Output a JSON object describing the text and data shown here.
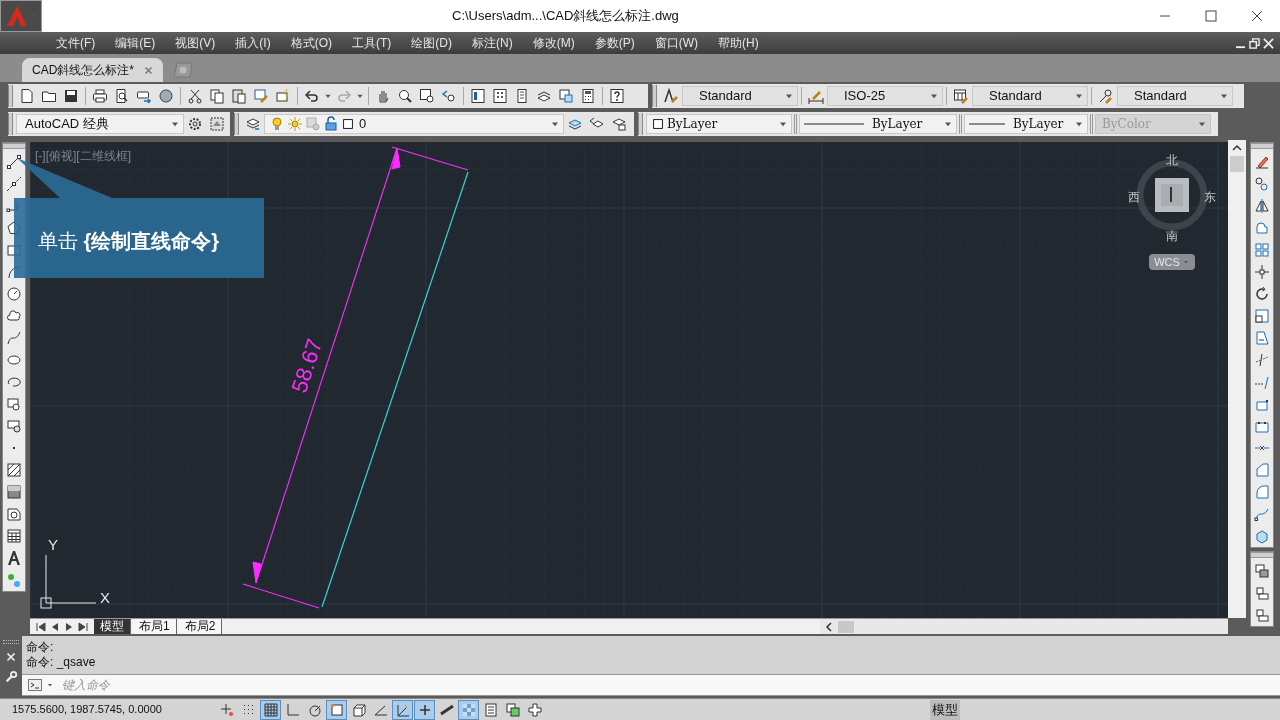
{
  "window": {
    "title": "C:\\Users\\adm...\\CAD斜线怎么标注.dwg"
  },
  "menu": [
    {
      "label": "文件(F)"
    },
    {
      "label": "编辑(E)"
    },
    {
      "label": "视图(V)"
    },
    {
      "label": "插入(I)"
    },
    {
      "label": "格式(O)"
    },
    {
      "label": "工具(T)"
    },
    {
      "label": "绘图(D)"
    },
    {
      "label": "标注(N)"
    },
    {
      "label": "修改(M)"
    },
    {
      "label": "参数(P)"
    },
    {
      "label": "窗口(W)"
    },
    {
      "label": "帮助(H)"
    }
  ],
  "document_tabs": [
    {
      "label": "CAD斜线怎么标注*",
      "selected": true
    }
  ],
  "style_toolbar": [
    {
      "kind": "text",
      "value": "Standard"
    },
    {
      "kind": "dimension",
      "value": "ISO-25"
    },
    {
      "kind": "table",
      "value": "Standard"
    },
    {
      "kind": "multileader",
      "value": "Standard"
    }
  ],
  "workspace": {
    "value": "AutoCAD 经典"
  },
  "layer": {
    "value": "0"
  },
  "properties": [
    {
      "kind": "color",
      "value": "ByLayer",
      "disabled": false
    },
    {
      "kind": "linetype",
      "value": "ByLayer",
      "disabled": false
    },
    {
      "kind": "lineweight",
      "value": "ByLayer",
      "disabled": false
    },
    {
      "kind": "plotstyle",
      "value": "ByColor",
      "disabled": true
    }
  ],
  "viewport": {
    "label": "[-][俯视][二维线框]",
    "tooltip": "单击 **{绘制直线命令}**",
    "dimension_text": "58.67",
    "viewcube": {
      "north": "北",
      "south": "南",
      "west": "西",
      "east": "东",
      "ucs": "WCS"
    },
    "ucs_icon": {
      "x": "X",
      "y": "Y"
    }
  },
  "layout_tabs": [
    {
      "label": "模型",
      "selected": true
    },
    {
      "label": "布局1",
      "selected": false
    },
    {
      "label": "布局2",
      "selected": false
    }
  ],
  "command_history": [
    "命令:",
    "命令: _qsave"
  ],
  "command_input": {
    "placeholder": "键入命令"
  },
  "status_bar": {
    "coordinates": "1575.5600, 1987.5745, 0.0000",
    "space": "模型",
    "toggles": [
      {
        "kind": "infer",
        "on": false
      },
      {
        "kind": "snap",
        "on": false
      },
      {
        "kind": "grid",
        "on": true
      },
      {
        "kind": "ortho",
        "on": false
      },
      {
        "kind": "polar",
        "on": false
      },
      {
        "kind": "osnap",
        "on": true
      },
      {
        "kind": "osnap3d",
        "on": false
      },
      {
        "kind": "otrack",
        "on": false
      },
      {
        "kind": "ducs",
        "on": true
      },
      {
        "kind": "dyn",
        "on": true
      },
      {
        "kind": "lweight",
        "on": false
      },
      {
        "kind": "transparency",
        "on": true
      },
      {
        "kind": "qp",
        "on": false
      },
      {
        "kind": "cycling",
        "on": false
      },
      {
        "kind": "monitor",
        "on": false
      }
    ]
  }
}
